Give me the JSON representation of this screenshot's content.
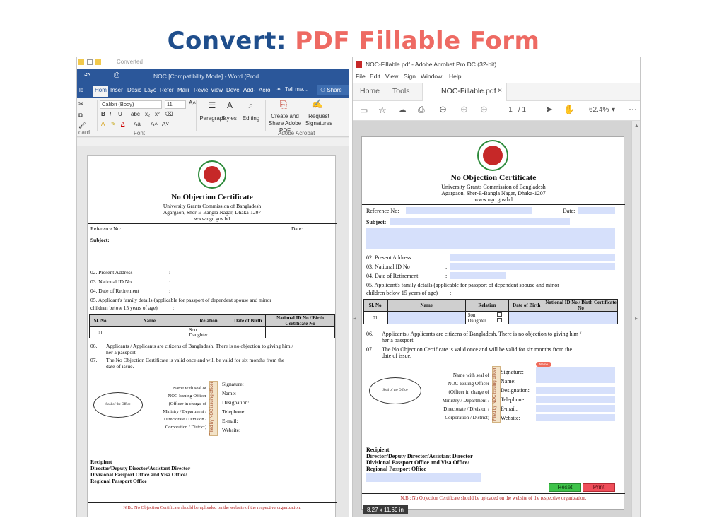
{
  "headline": {
    "prefix": "Convert:",
    "suffix": "PDF Fillable Form"
  },
  "word": {
    "qat_text": "Converted",
    "title": "NOC [Compatibility Mode] - Word (Prod...",
    "tabs": [
      "Hom",
      "Inser",
      "Desic",
      "Layo",
      "Refer",
      "Maili",
      "Revie",
      "View",
      "Deve",
      "Add-",
      "Acrol"
    ],
    "tell_me": "Tell me...",
    "share": "Share",
    "font_name": "Calibri (Body)",
    "font_size": "11",
    "groups": {
      "clipboard": "oard",
      "font": "Font",
      "acrobat": "Adobe Acrobat"
    },
    "buttons": {
      "paragraph": "Paragraph",
      "styles": "Styles",
      "editing": "Editing",
      "create_share": "Create and Share Adobe PDF",
      "request_sig": "Request Signatures"
    }
  },
  "acrobat": {
    "title": "NOC-Fillable.pdf - Adobe Acrobat Pro DC (32-bit)",
    "menu": [
      "File",
      "Edit",
      "View",
      "Sign",
      "Window",
      "Help"
    ],
    "tab_home": "Home",
    "tab_tools": "Tools",
    "tab_doc": "NOC-Fillable.pdf",
    "page_current": "1",
    "page_total": "/ 1",
    "zoom": "62.4%",
    "page_size": "8.27 x 11.69 in",
    "reset_label": "Reset",
    "print_label": "Print",
    "sig_tag": "Name"
  },
  "form": {
    "title": "No Objection Certificate",
    "org": "University Grants Commission of Bangladesh",
    "address": "Agargaon, Sher-E-Bangla Nagar, Dhaka-1207",
    "web": "www.ugc.gov.bd",
    "ref_label": "Reference No:",
    "date_label": "Date:",
    "subject_label": "Subject:",
    "present_address": "02. Present Address",
    "nid": "03. National ID No",
    "retirement": "04. Date of Retirement",
    "family_1": "05. Applicant's family details (applicable for passport of dependent spouse and minor",
    "family_2": "children below 15 years of age)",
    "colon": ":",
    "table_headers": [
      "Sl. No.",
      "Name",
      "Relation",
      "Date of Birth",
      "National ID No / Birth Certificate No"
    ],
    "row_num": "01.",
    "son": "Son",
    "daughter": "Daughter",
    "item06_num": "06.",
    "item06_l1": "Applicants / Applicants are citizens of Bangladesh. There is no objection to giving him /",
    "item06_l2": "her a passport.",
    "item07_num": "07.",
    "item07_l1": "The No Objection Certificate is valid once and will be valid for six months from the",
    "item07_l2": "date of issue.",
    "seal_office": "Seal of the Office",
    "seal_lines": [
      "Name with seal of",
      "NOC Issuing Officer",
      "(Officer in charge of",
      "Ministry / Department /",
      "Directorate / Division /",
      "Corporation / District)"
    ],
    "vstamp": "Filled by NOC issuing officer",
    "sig_labels": [
      "Signature:",
      "Name:",
      "Designation:",
      "Telephone:",
      "E-mail:",
      "Website:"
    ],
    "recipient": "Recipient",
    "recip_1": "Director/Deputy Director/Assistant Director",
    "recip_2": "Divisional Passport Office and Visa Office/",
    "recip_3": "Regional Passport Office",
    "nb": "N.B.: No Objection Certificate should be uploaded on the website of the respective organization."
  }
}
